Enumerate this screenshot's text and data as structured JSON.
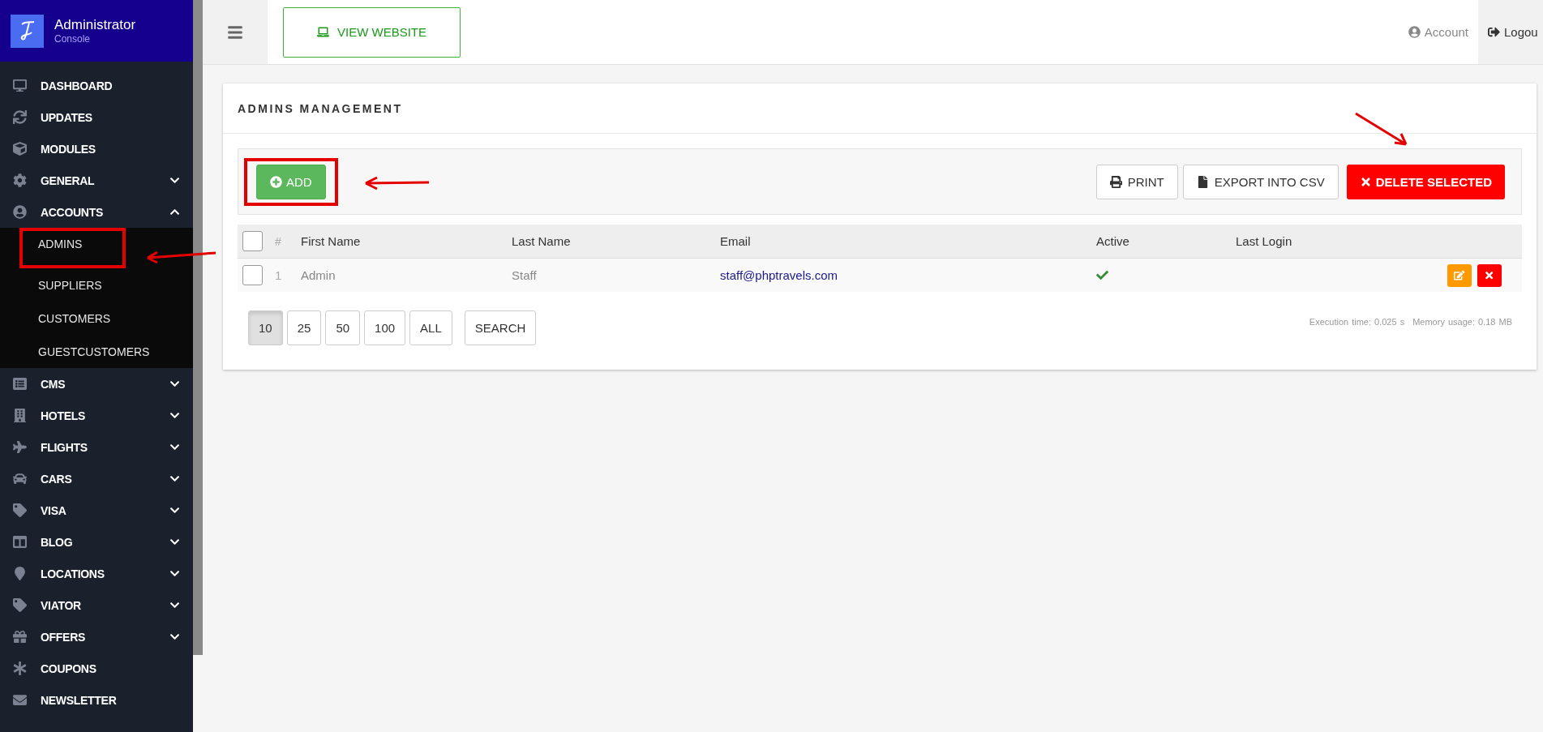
{
  "brand": {
    "title": "Administrator",
    "subtitle": "Console"
  },
  "sidebar": {
    "items": [
      {
        "label": "DASHBOARD"
      },
      {
        "label": "UPDATES"
      },
      {
        "label": "MODULES"
      },
      {
        "label": "GENERAL",
        "expanded": false
      },
      {
        "label": "ACCOUNTS",
        "expanded": true,
        "children": [
          {
            "label": "ADMINS",
            "highlighted": true
          },
          {
            "label": "SUPPLIERS",
            "highlighted": false
          },
          {
            "label": "CUSTOMERS",
            "highlighted": false
          },
          {
            "label": "GUESTCUSTOMERS",
            "highlighted": false
          }
        ]
      },
      {
        "label": "CMS",
        "expanded": false
      },
      {
        "label": "HOTELS",
        "expanded": false
      },
      {
        "label": "FLIGHTS",
        "expanded": false
      },
      {
        "label": "CARS",
        "expanded": false
      },
      {
        "label": "VISA",
        "expanded": false
      },
      {
        "label": "BLOG",
        "expanded": false
      },
      {
        "label": "LOCATIONS",
        "expanded": false
      },
      {
        "label": "VIATOR",
        "expanded": false
      },
      {
        "label": "OFFERS",
        "expanded": false
      },
      {
        "label": "COUPONS"
      },
      {
        "label": "NEWSLETTER"
      }
    ]
  },
  "topbar": {
    "view_website": "VIEW WEBSITE",
    "account": "Account",
    "logout": "Logou"
  },
  "panel": {
    "title": "ADMINS MANAGEMENT",
    "add": {
      "label": "ADD",
      "highlighted": true
    },
    "print": "PRINT",
    "export": "EXPORT INTO CSV",
    "delete": {
      "label": "DELETE SELECTED",
      "pointed": true
    }
  },
  "table": {
    "columns": [
      "#",
      "First Name",
      "Last Name",
      "Email",
      "Active",
      "Last Login"
    ],
    "header_checked": false,
    "rows": [
      {
        "checked": false,
        "number": "1",
        "first_name": "Admin",
        "last_name": "Staff",
        "email": "staff@phptravels.com",
        "active": true
      }
    ]
  },
  "page_sizes": [
    {
      "label": "10",
      "selected": true
    },
    {
      "label": "25",
      "selected": false
    },
    {
      "label": "50",
      "selected": false
    },
    {
      "label": "100",
      "selected": false
    },
    {
      "label": "ALL",
      "selected": false
    }
  ],
  "search": "SEARCH",
  "footer": {
    "execution": "Execution time: 0.025 s",
    "memory": "Memory usage: 0.18 MB"
  }
}
